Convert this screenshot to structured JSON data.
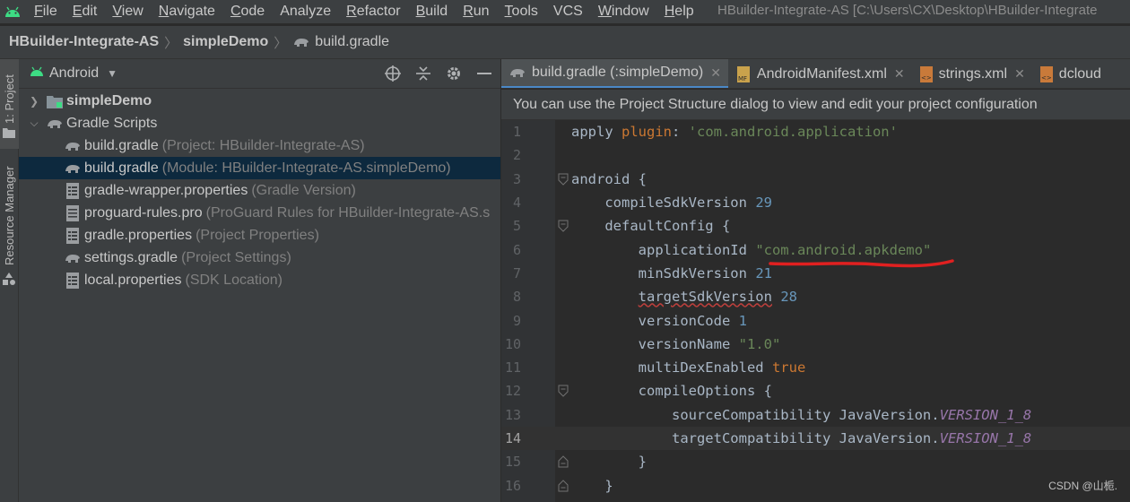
{
  "menu": {
    "items": [
      {
        "label": "File",
        "u": "F",
        "rest": "ile"
      },
      {
        "label": "Edit",
        "u": "E",
        "rest": "dit"
      },
      {
        "label": "View",
        "u": "V",
        "rest": "iew"
      },
      {
        "label": "Navigate",
        "u": "N",
        "rest": "avigate"
      },
      {
        "label": "Code",
        "u": "C",
        "rest": "ode"
      },
      {
        "label": "Analyze",
        "u": "",
        "rest": "Analyze"
      },
      {
        "label": "Refactor",
        "u": "R",
        "rest": "efactor"
      },
      {
        "label": "Build",
        "u": "B",
        "rest": "uild"
      },
      {
        "label": "Run",
        "u": "R",
        "rest": "un"
      },
      {
        "label": "Tools",
        "u": "T",
        "rest": "ools"
      },
      {
        "label": "VCS",
        "u": "",
        "rest": "VCS"
      },
      {
        "label": "Window",
        "u": "W",
        "rest": "indow"
      },
      {
        "label": "Help",
        "u": "H",
        "rest": "elp"
      }
    ],
    "window_title": "HBuilder-Integrate-AS [C:\\Users\\CX\\Desktop\\HBuilder-Integrate"
  },
  "breadcrumb": {
    "project": "HBuilder-Integrate-AS",
    "module": "simpleDemo",
    "file": "build.gradle"
  },
  "toolstrip": {
    "project_tab": "1: Project",
    "resource_tab": "Resource Manager"
  },
  "project_panel": {
    "view_mode": "Android",
    "tree": [
      {
        "arrow": "›",
        "name": "simpleDemo",
        "hint": "",
        "bold": true,
        "icon": "folder-module-icon"
      },
      {
        "arrow": "⌄",
        "name": "Gradle Scripts",
        "hint": "",
        "bold": false,
        "icon": "gradle-elephant-icon"
      },
      {
        "arrow": "",
        "name": "build.gradle",
        "hint": "(Project: HBuilder-Integrate-AS)",
        "bold": false,
        "icon": "gradle-elephant-icon"
      },
      {
        "arrow": "",
        "name": "build.gradle",
        "hint": "(Module: HBuilder-Integrate-AS.simpleDemo)",
        "bold": false,
        "icon": "gradle-elephant-icon",
        "selected": true
      },
      {
        "arrow": "",
        "name": "gradle-wrapper.properties",
        "hint": "(Gradle Version)",
        "bold": false,
        "icon": "properties-file-icon"
      },
      {
        "arrow": "",
        "name": "proguard-rules.pro",
        "hint": "(ProGuard Rules for HBuilder-Integrate-AS.s",
        "bold": false,
        "icon": "text-file-icon"
      },
      {
        "arrow": "",
        "name": "gradle.properties",
        "hint": "(Project Properties)",
        "bold": false,
        "icon": "properties-file-icon"
      },
      {
        "arrow": "",
        "name": "settings.gradle",
        "hint": "(Project Settings)",
        "bold": false,
        "icon": "gradle-elephant-icon"
      },
      {
        "arrow": "",
        "name": "local.properties",
        "hint": "(SDK Location)",
        "bold": false,
        "icon": "properties-file-icon"
      }
    ]
  },
  "editor": {
    "tabs": [
      {
        "label": "build.gradle (:simpleDemo)",
        "icon": "gradle-elephant-icon",
        "active": true,
        "closable": true
      },
      {
        "label": "AndroidManifest.xml",
        "icon": "manifest-icon",
        "active": false,
        "closable": true
      },
      {
        "label": "strings.xml",
        "icon": "xml-file-icon",
        "active": false,
        "closable": true
      },
      {
        "label": "dcloud",
        "icon": "xml-file-icon",
        "active": false,
        "closable": false
      }
    ],
    "banner": "You can use the Project Structure dialog to view and edit your project configuration",
    "current_line": 14,
    "lines": [
      {
        "n": "1",
        "fold": "",
        "html": "apply plugin: 'com.android.application'"
      },
      {
        "n": "2",
        "fold": "",
        "html": ""
      },
      {
        "n": "3",
        "fold": "open",
        "html": "android {"
      },
      {
        "n": "4",
        "fold": "",
        "html": "    compileSdkVersion 29"
      },
      {
        "n": "5",
        "fold": "open",
        "html": "    defaultConfig {"
      },
      {
        "n": "6",
        "fold": "",
        "html": "        applicationId \"com.android.apkdemo\""
      },
      {
        "n": "7",
        "fold": "",
        "html": "        minSdkVersion 21"
      },
      {
        "n": "8",
        "fold": "",
        "html": "        targetSdkVersion 28"
      },
      {
        "n": "9",
        "fold": "",
        "html": "        versionCode 1"
      },
      {
        "n": "10",
        "fold": "",
        "html": "        versionName \"1.0\""
      },
      {
        "n": "11",
        "fold": "",
        "html": "        multiDexEnabled true"
      },
      {
        "n": "12",
        "fold": "open",
        "html": "        compileOptions {"
      },
      {
        "n": "13",
        "fold": "",
        "html": "            sourceCompatibility JavaVersion.VERSION_1_8"
      },
      {
        "n": "14",
        "fold": "",
        "html": "            targetCompatibility JavaVersion.VERSION_1_8"
      },
      {
        "n": "15",
        "fold": "close",
        "html": "        }"
      },
      {
        "n": "16",
        "fold": "close",
        "html": "    }"
      }
    ]
  },
  "watermark": "CSDN @山栀.",
  "colors": {
    "keyword": "#cc7832",
    "string": "#6a8759",
    "number": "#6897bb",
    "constant": "#9876aa",
    "annotation_red": "#e02020"
  }
}
